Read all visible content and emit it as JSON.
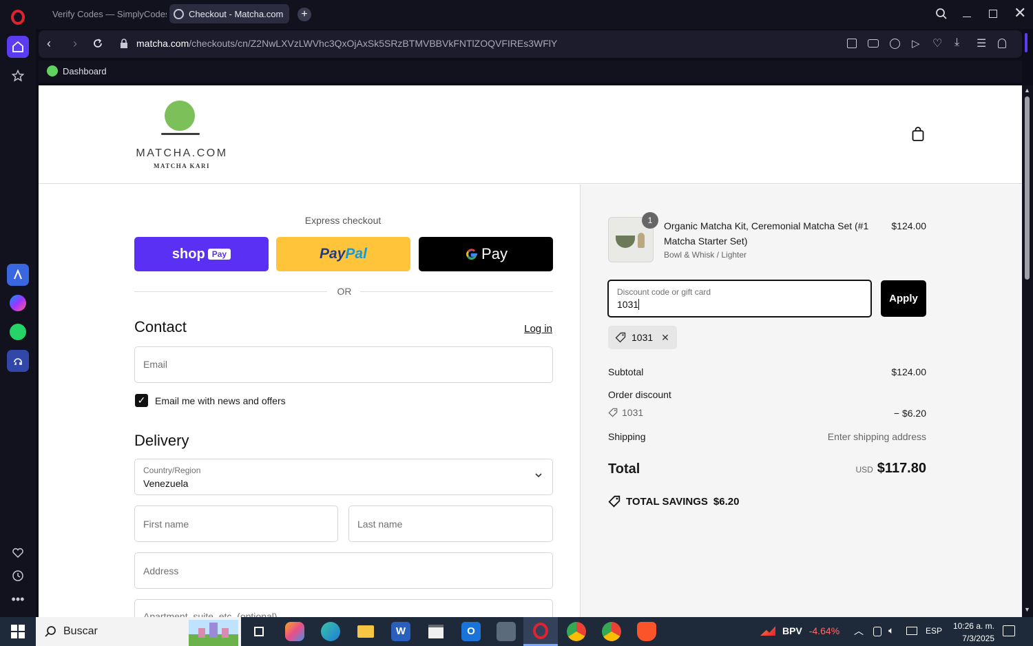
{
  "browser": {
    "tabs": [
      {
        "title": "Verify Codes — SimplyCodes",
        "active": false
      },
      {
        "title": "Checkout - Matcha.com",
        "active": true
      }
    ],
    "url_host": "matcha.com",
    "url_path": "/checkouts/cn/Z2NwLXVzLWVhc3QxOjAxSk5SRzBTMVBBVkFNTlZOQVFIREs3WFlY",
    "bookmark": "Dashboard"
  },
  "store": {
    "logo_name": "MATCHA.COM",
    "logo_sub": "MATCHA KARI"
  },
  "checkout": {
    "express_label": "Express checkout",
    "shop_pay": "shop",
    "shop_pay_badge": "Pay",
    "paypal_a": "Pay",
    "paypal_b": "Pal",
    "gpay": "Pay",
    "or_label": "OR",
    "contact_heading": "Contact",
    "login_link": "Log in",
    "email_placeholder": "Email",
    "news_checkbox_label": "Email me with news and offers",
    "delivery_heading": "Delivery",
    "country_label": "Country/Region",
    "country_value": "Venezuela",
    "first_name_placeholder": "First name",
    "last_name_placeholder": "Last name",
    "address_placeholder": "Address",
    "apartment_placeholder": "Apartment, suite, etc. (optional)"
  },
  "summary": {
    "item_qty": "1",
    "item_name_line1": "Organic Matcha Kit, Ceremonial Matcha Set (#1",
    "item_name_line2": "Matcha Starter Set)",
    "item_variant": "Bowl & Whisk / Lighter",
    "item_price": "$124.00",
    "discount_label": "Discount code or gift card",
    "discount_value": "1031",
    "apply_button": "Apply",
    "applied_code": "1031",
    "subtotal_label": "Subtotal",
    "subtotal_value": "$124.00",
    "order_discount_label": "Order discount",
    "order_discount_code": "1031",
    "order_discount_value": "− $6.20",
    "shipping_label": "Shipping",
    "shipping_value": "Enter shipping address",
    "total_label": "Total",
    "total_currency": "USD",
    "total_value": "$117.80",
    "savings_label": "TOTAL SAVINGS",
    "savings_value": "$6.20"
  },
  "taskbar": {
    "search_placeholder": "Buscar",
    "stock_ticker": "BPV",
    "stock_change": "-4.64%",
    "language": "ESP",
    "time": "10:26 a. m.",
    "date": "7/3/2025"
  },
  "colors": {
    "shop_pay": "#5a31f4",
    "paypal": "#ffc439",
    "gpay": "#000000",
    "apply": "#000000",
    "stock_change": "#ff6b6b"
  }
}
